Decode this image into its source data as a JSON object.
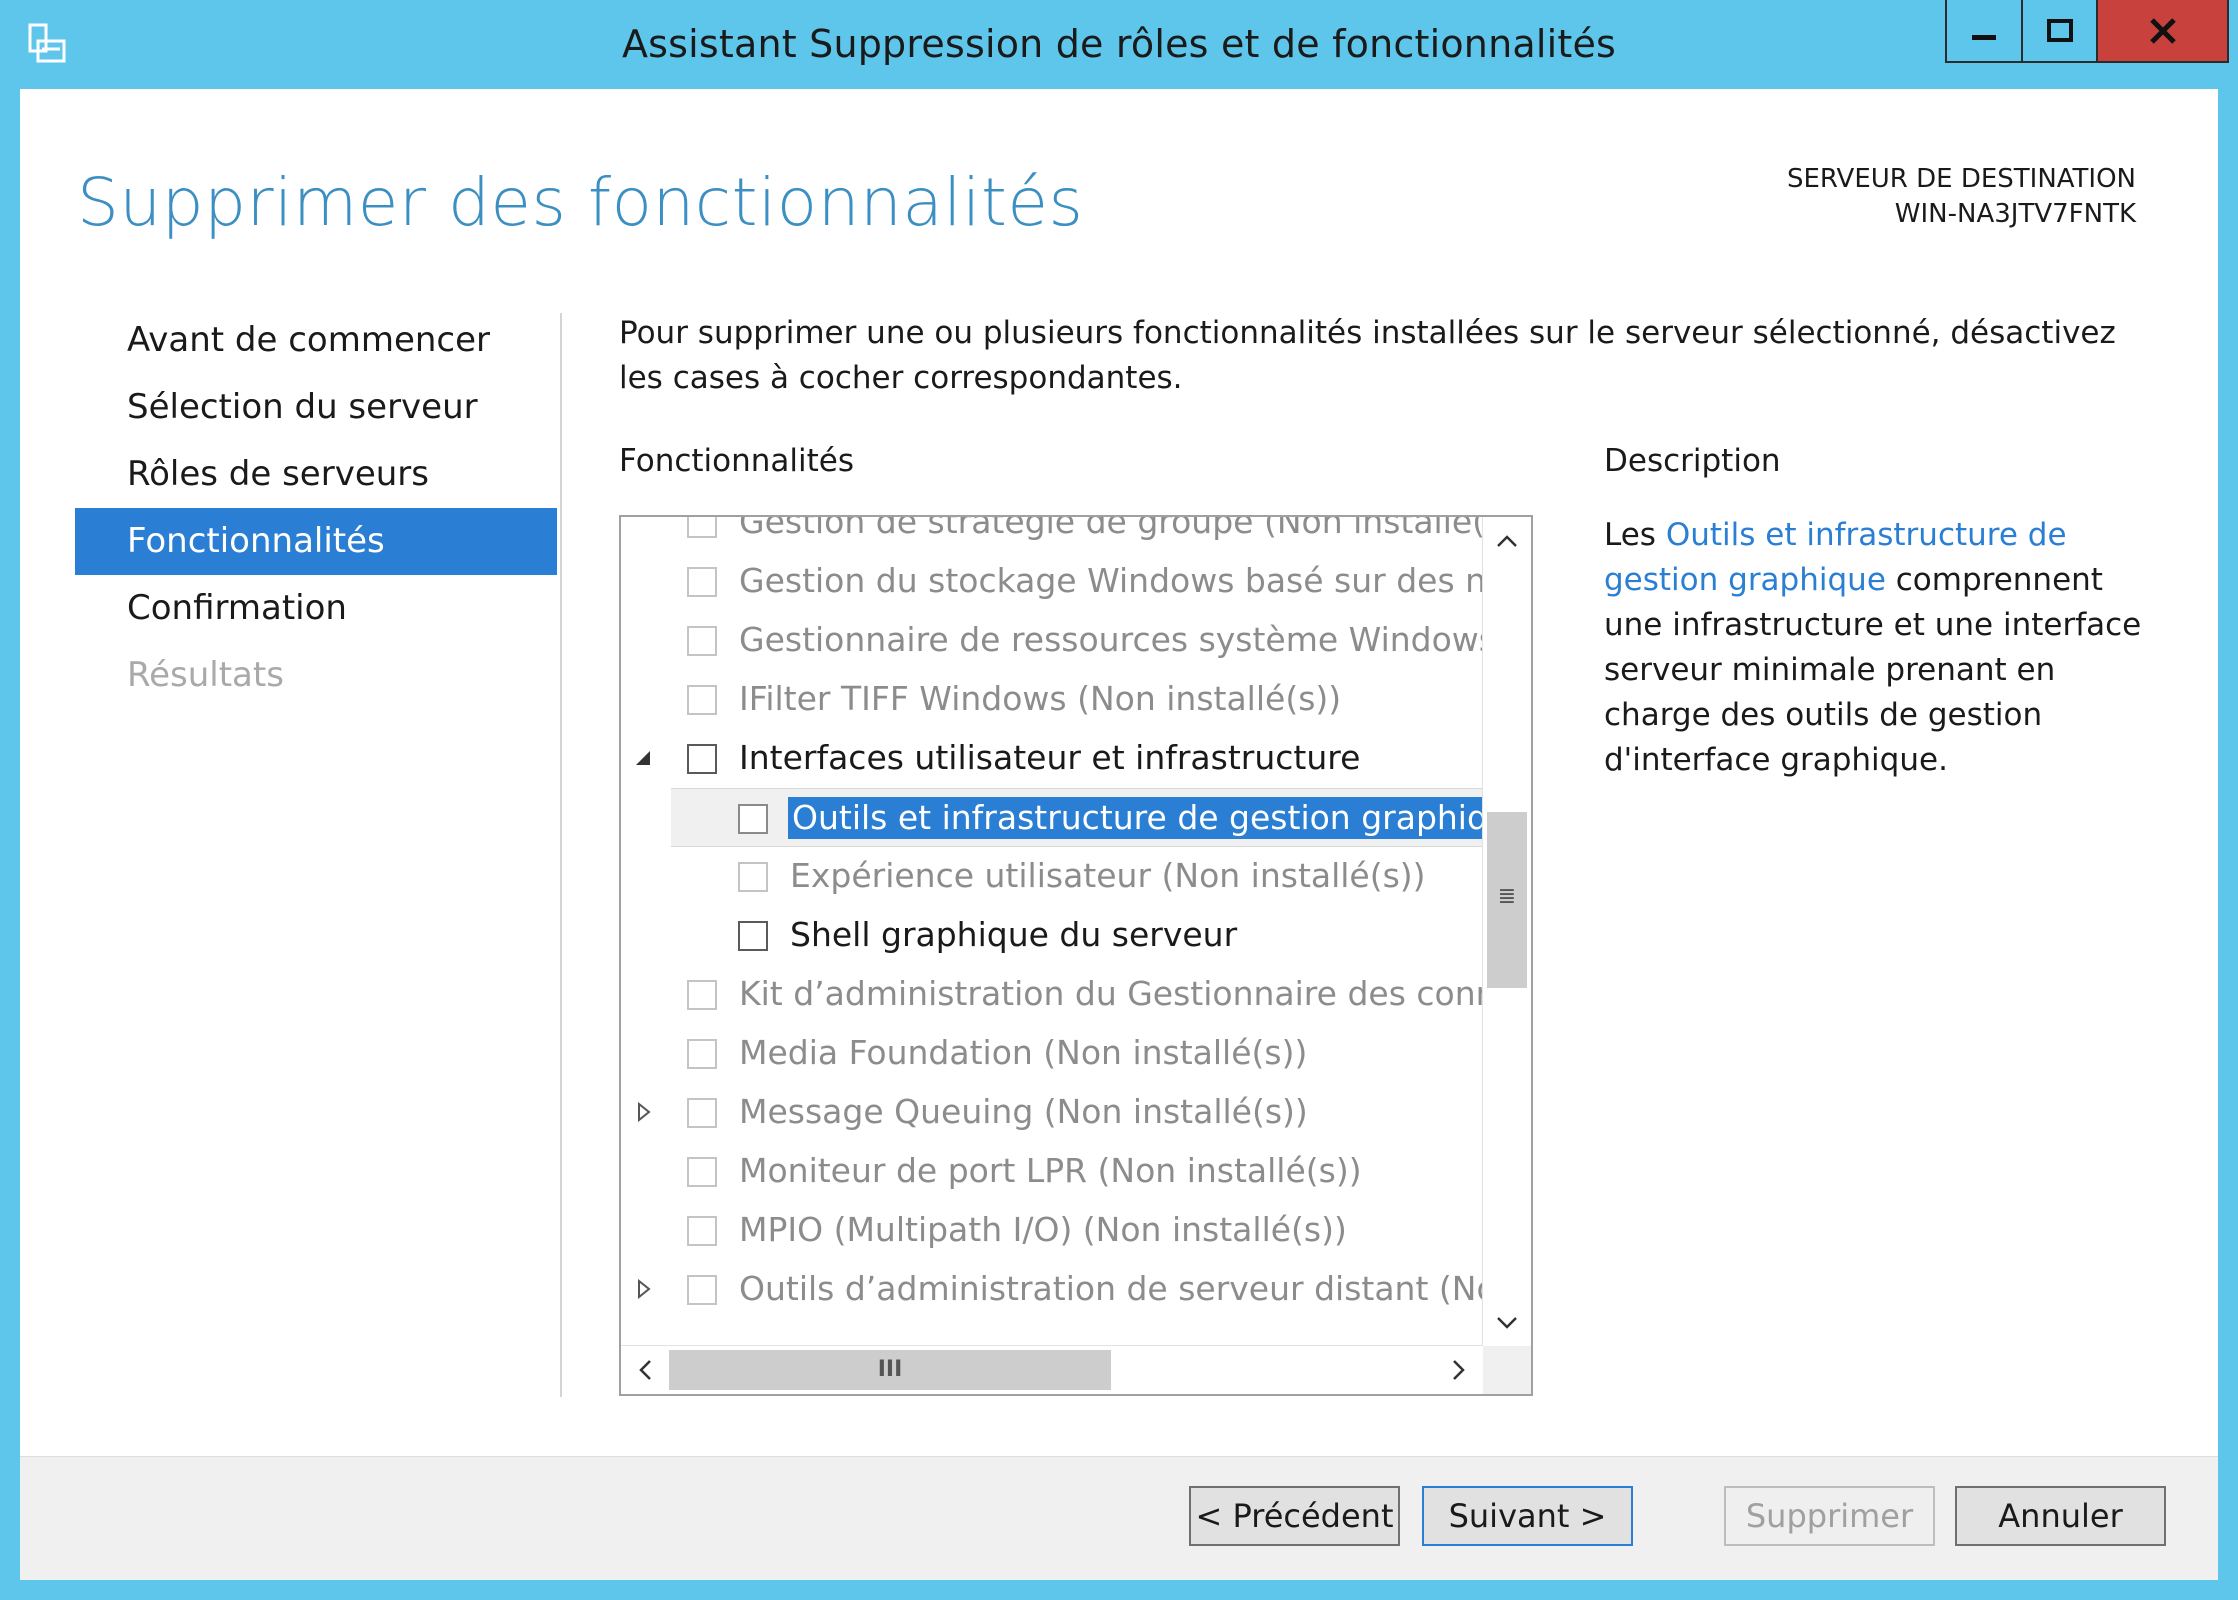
{
  "window": {
    "title": "Assistant Suppression de rôles et de fonctionnalités"
  },
  "page": {
    "heading": "Supprimer des fonctionnalités",
    "destination_label": "SERVEUR DE DESTINATION",
    "destination_name": "WIN-NA3JTV7FNTK"
  },
  "nav": {
    "items": [
      {
        "label": "Avant de commencer",
        "state": "normal"
      },
      {
        "label": "Sélection du serveur",
        "state": "normal"
      },
      {
        "label": "Rôles de serveurs",
        "state": "normal"
      },
      {
        "label": "Fonctionnalités",
        "state": "selected"
      },
      {
        "label": "Confirmation",
        "state": "normal"
      },
      {
        "label": "Résultats",
        "state": "disabled"
      }
    ]
  },
  "main": {
    "intro": "Pour supprimer une ou plusieurs fonctionnalités installées sur le serveur sélectionné, désactivez les cases à cocher correspondantes.",
    "features_label": "Fonctionnalités",
    "features": [
      {
        "label": "Gestion de stratégie de groupe (Non installé(s))",
        "level": 0,
        "state": "gray",
        "expander": "none",
        "checked": false,
        "partial": true
      },
      {
        "label": "Gestion du stockage Windows basé sur des normes",
        "level": 0,
        "state": "gray",
        "expander": "none",
        "checked": false
      },
      {
        "label": "Gestionnaire de ressources système Windows (déconseillé)",
        "level": 0,
        "state": "gray",
        "expander": "none",
        "checked": false
      },
      {
        "label": "IFilter TIFF Windows (Non installé(s))",
        "level": 0,
        "state": "gray",
        "expander": "none",
        "checked": false
      },
      {
        "label": "Interfaces utilisateur et infrastructure",
        "level": 0,
        "state": "dark",
        "expander": "expanded",
        "checked": false
      },
      {
        "label": "Outils et infrastructure de gestion graphique",
        "level": 1,
        "state": "selected",
        "expander": "none",
        "checked": false
      },
      {
        "label": "Expérience utilisateur (Non installé(s))",
        "level": 1,
        "state": "gray",
        "expander": "none",
        "checked": false
      },
      {
        "label": "Shell graphique du serveur",
        "level": 1,
        "state": "dark",
        "expander": "none",
        "checked": false
      },
      {
        "label": "Kit d’administration du Gestionnaire des connexions",
        "level": 0,
        "state": "gray",
        "expander": "none",
        "checked": false
      },
      {
        "label": "Media Foundation (Non installé(s))",
        "level": 0,
        "state": "gray",
        "expander": "none",
        "checked": false
      },
      {
        "label": "Message Queuing (Non installé(s))",
        "level": 0,
        "state": "gray",
        "expander": "collapsed",
        "checked": false
      },
      {
        "label": "Moniteur de port LPR (Non installé(s))",
        "level": 0,
        "state": "gray",
        "expander": "none",
        "checked": false
      },
      {
        "label": "MPIO (Multipath I/O) (Non installé(s))",
        "level": 0,
        "state": "gray",
        "expander": "none",
        "checked": false
      },
      {
        "label": "Outils d’administration de serveur distant (Non installé(s))",
        "level": 0,
        "state": "gray",
        "expander": "collapsed",
        "checked": false
      }
    ],
    "scroll": {
      "up": "chevron-up-icon",
      "down": "chevron-down-icon",
      "left": "chevron-left-icon",
      "right": "chevron-right-icon",
      "v_grip": "≣",
      "h_grip": "III"
    }
  },
  "description": {
    "label": "Description",
    "prefix": "Les ",
    "link": "Outils et infrastructure de gestion graphique",
    "rest": " comprennent une infrastructure et une interface serveur minimale prenant en charge des outils de gestion d'interface graphique."
  },
  "footer": {
    "previous": "< Précédent",
    "next": "Suivant >",
    "remove": "Supprimer",
    "cancel": "Annuler"
  },
  "colors": {
    "titlebar": "#5ec6ea",
    "accent": "#2a7fd4",
    "heading": "#3c8fc2",
    "close": "#c8413d"
  }
}
